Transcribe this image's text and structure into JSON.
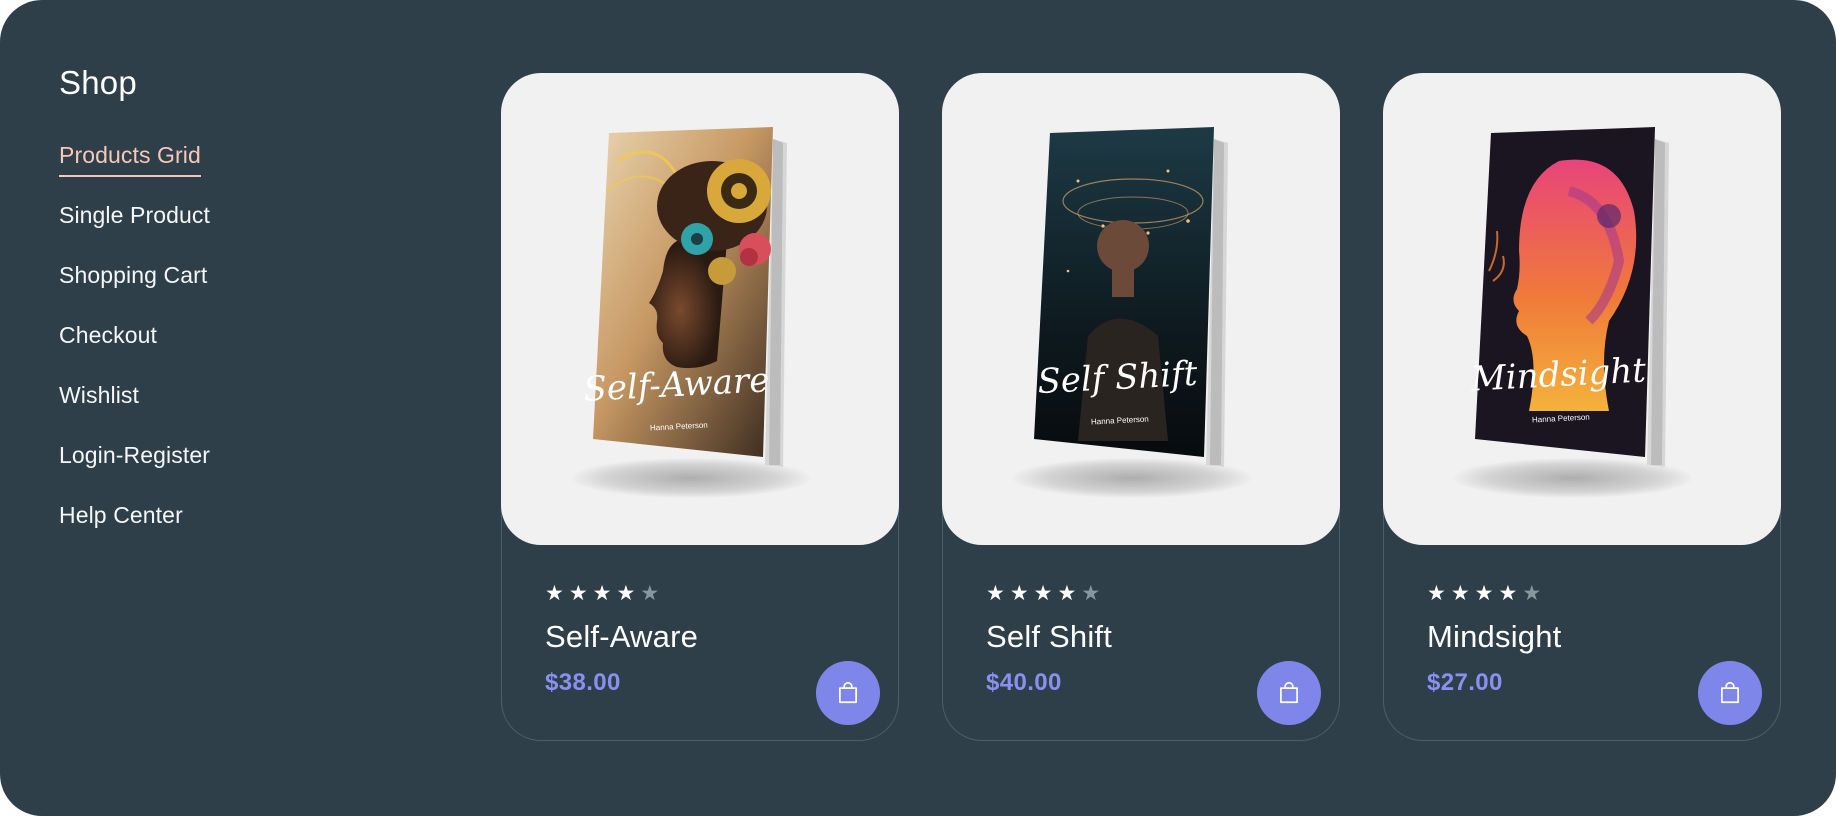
{
  "sidebar": {
    "title": "Shop",
    "items": [
      {
        "label": "Products Grid",
        "active": true
      },
      {
        "label": "Single Product"
      },
      {
        "label": "Shopping Cart"
      },
      {
        "label": "Checkout"
      },
      {
        "label": "Wishlist"
      },
      {
        "label": "Login-Register"
      },
      {
        "label": "Help Center"
      }
    ]
  },
  "products": [
    {
      "title": "Self-Aware",
      "price": "$38.00",
      "rating": 4,
      "rating_max": 5,
      "cover_title": "Self-Aware",
      "cover_author": "Hanna Peterson",
      "cart_icon": "shopping-bag-icon"
    },
    {
      "title": "Self Shift",
      "price": "$40.00",
      "rating": 4,
      "rating_max": 5,
      "cover_title": "Self Shift",
      "cover_author": "Hanna Peterson",
      "cart_icon": "shopping-bag-icon"
    },
    {
      "title": "Mindsight",
      "price": "$27.00",
      "rating": 4,
      "rating_max": 5,
      "cover_title": "Mindsight",
      "cover_author": "Hanna Peterson",
      "cart_icon": "shopping-bag-icon"
    }
  ],
  "colors": {
    "background": "#2f3f49",
    "active_nav": "#f5c9b8",
    "price": "#8c8ff2",
    "cart_button": "#7f86ea",
    "card_image_bg": "#f1f1f1"
  }
}
